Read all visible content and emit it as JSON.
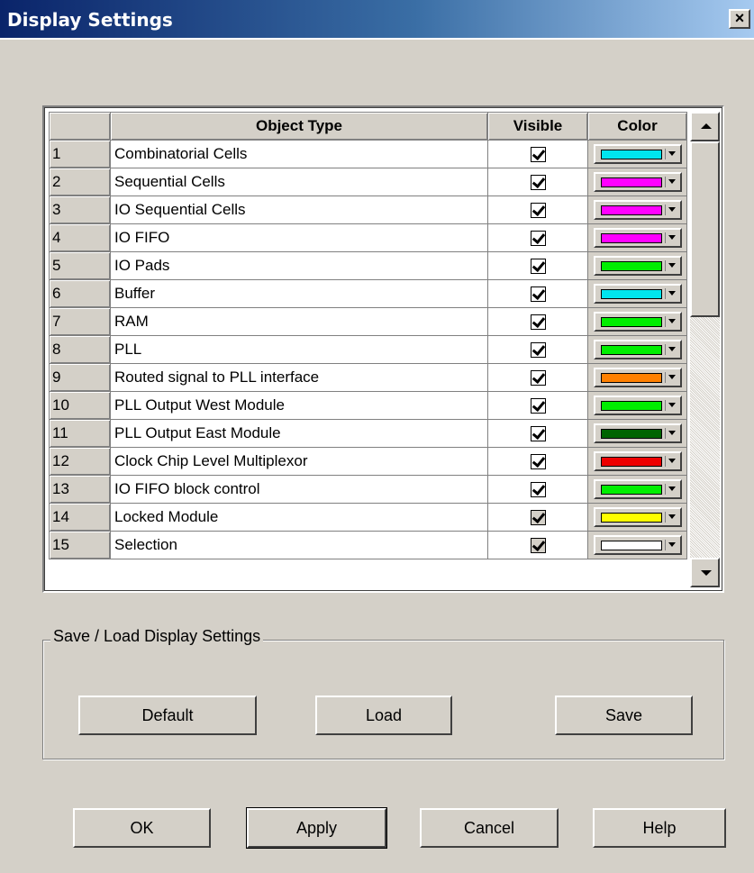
{
  "window": {
    "title": "Display Settings",
    "close_label": "×"
  },
  "grid": {
    "headers": {
      "num": "",
      "object_type": "Object Type",
      "visible": "Visible",
      "color": "Color"
    },
    "rows": [
      {
        "num": "1",
        "name": "Combinatorial Cells",
        "visible": true,
        "color": "#00e5ee"
      },
      {
        "num": "2",
        "name": "Sequential Cells",
        "visible": true,
        "color": "#ff00ff"
      },
      {
        "num": "3",
        "name": "IO Sequential Cells",
        "visible": true,
        "color": "#ff00ff"
      },
      {
        "num": "4",
        "name": "IO FIFO",
        "visible": true,
        "color": "#ff00ff"
      },
      {
        "num": "5",
        "name": "IO Pads",
        "visible": true,
        "color": "#00ee00"
      },
      {
        "num": "6",
        "name": "Buffer",
        "visible": true,
        "color": "#00e5ee"
      },
      {
        "num": "7",
        "name": "RAM",
        "visible": true,
        "color": "#00ee00"
      },
      {
        "num": "8",
        "name": "PLL",
        "visible": true,
        "color": "#00ee00"
      },
      {
        "num": "9",
        "name": "Routed signal to PLL interface",
        "visible": true,
        "color": "#ff8000"
      },
      {
        "num": "10",
        "name": "PLL Output West Module",
        "visible": true,
        "color": "#00ee00"
      },
      {
        "num": "11",
        "name": "PLL Output East Module",
        "visible": true,
        "color": "#006400"
      },
      {
        "num": "12",
        "name": "Clock Chip Level Multiplexor",
        "visible": true,
        "color": "#ee0000"
      },
      {
        "num": "13",
        "name": "IO FIFO block control",
        "visible": true,
        "color": "#00ee00"
      },
      {
        "num": "14",
        "name": "Locked Module",
        "visible": true,
        "color": "#ffff00",
        "disabled": true
      },
      {
        "num": "15",
        "name": "Selection",
        "visible": true,
        "color": "#ffffff",
        "disabled": true
      }
    ]
  },
  "save_load": {
    "legend": "Save / Load Display Settings",
    "default_label": "Default",
    "load_label": "Load",
    "save_label": "Save"
  },
  "footer": {
    "ok_label": "OK",
    "apply_label": "Apply",
    "cancel_label": "Cancel",
    "help_label": "Help"
  }
}
